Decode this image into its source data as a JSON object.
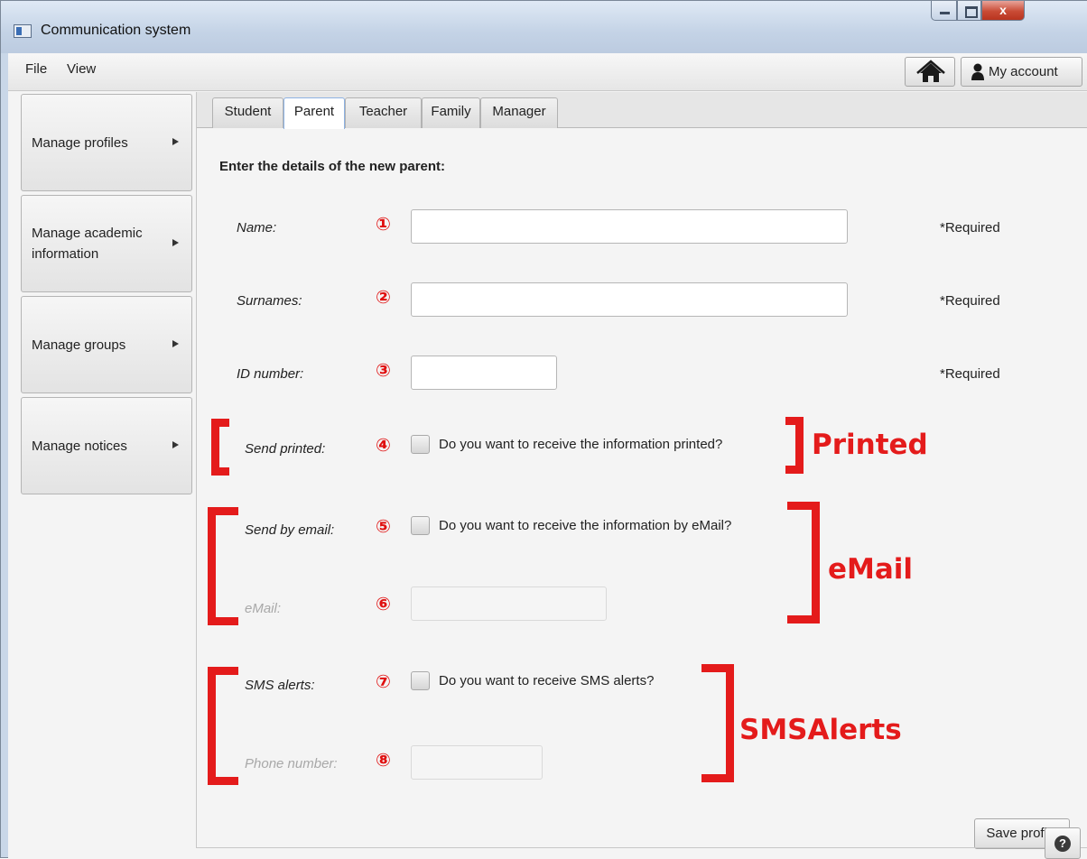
{
  "window": {
    "title": "Communication system",
    "close_glyph": "x"
  },
  "menubar": {
    "items": [
      {
        "label": "File"
      },
      {
        "label": "View"
      }
    ],
    "home_icon": "home-icon",
    "account_label": "My account",
    "account_icon": "user-icon"
  },
  "sidebar": {
    "items": [
      {
        "label": "Manage profiles"
      },
      {
        "label": "Manage academic information"
      },
      {
        "label": "Manage groups"
      },
      {
        "label": "Manage notices"
      }
    ]
  },
  "tabs": [
    {
      "label": "Student",
      "active": false
    },
    {
      "label": "Parent",
      "active": true
    },
    {
      "label": "Teacher",
      "active": false
    },
    {
      "label": "Family",
      "active": false
    },
    {
      "label": "Manager",
      "active": false
    }
  ],
  "form": {
    "heading": "Enter the details of the new parent:",
    "name": {
      "label": "Name:",
      "marker": "①",
      "value": "",
      "required": "*Required"
    },
    "surnames": {
      "label": "Surnames:",
      "marker": "②",
      "value": "",
      "required": "*Required"
    },
    "id_number": {
      "label": "ID number:",
      "marker": "③",
      "value": "",
      "required": "*Required"
    },
    "send_printed": {
      "label": "Send printed:",
      "marker": "④",
      "checkbox_text": "Do you want to receive the information printed?",
      "checked": false
    },
    "send_email": {
      "label": "Send by email:",
      "marker": "⑤",
      "checkbox_text": "Do you want to receive the information by eMail?",
      "checked": false
    },
    "email": {
      "label": "eMail:",
      "marker": "⑥",
      "value": "",
      "disabled": true
    },
    "sms_alerts": {
      "label": "SMS alerts:",
      "marker": "⑦",
      "checkbox_text": "Do you want to receive SMS alerts?",
      "checked": false
    },
    "phone": {
      "label": "Phone number:",
      "marker": "⑧",
      "value": "",
      "disabled": true
    },
    "save_label": "Save profile"
  },
  "annotations": {
    "printed": "Printed",
    "email": "eMail",
    "sms": "SMSAlerts",
    "color": "#e41b1b"
  },
  "help_glyph": "?",
  "help_icon": "help-icon"
}
